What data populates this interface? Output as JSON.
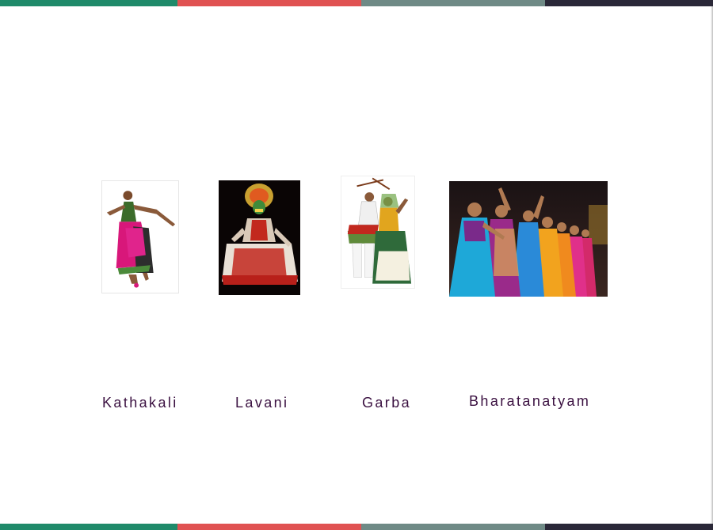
{
  "colors": {
    "stripe": [
      "#1f8a6a",
      "#e05252",
      "#6f8a86",
      "#2a2838"
    ],
    "label_text": "#3a1040"
  },
  "dances": [
    {
      "label": "Kathakali"
    },
    {
      "label": "Lavani"
    },
    {
      "label": "Garba"
    },
    {
      "label": "Bharatanatyam"
    }
  ]
}
